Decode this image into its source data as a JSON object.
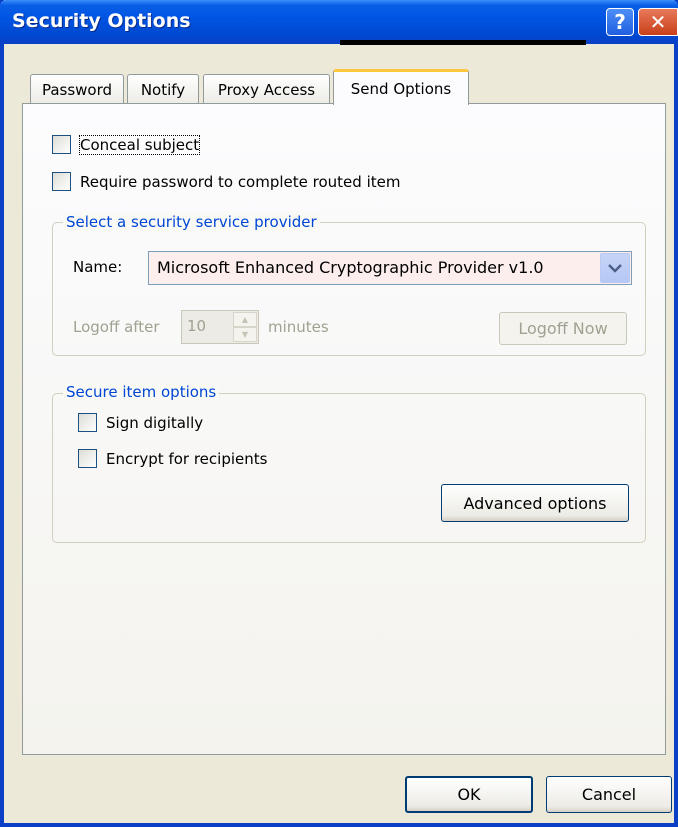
{
  "window": {
    "title": "Security Options"
  },
  "titlebar_buttons": {
    "help": "?",
    "close": "✕"
  },
  "tabs": [
    {
      "label": "Password"
    },
    {
      "label": "Notify"
    },
    {
      "label": "Proxy Access"
    },
    {
      "label": "Send Options",
      "active": true
    }
  ],
  "options": {
    "conceal_subject": {
      "label": "Conceal subject",
      "checked": false
    },
    "require_password": {
      "label": "Require password to complete routed item",
      "checked": false
    }
  },
  "provider_group": {
    "title": "Select a security service provider",
    "name_label": "Name:",
    "name_value": "Microsoft Enhanced Cryptographic Provider v1.0",
    "logoff_label": "Logoff after",
    "logoff_value": "10",
    "minutes_label": "minutes",
    "logoff_now_label": "Logoff Now"
  },
  "secure_group": {
    "title": "Secure item options",
    "sign_digitally": {
      "label": "Sign digitally",
      "checked": false
    },
    "encrypt": {
      "label": "Encrypt for recipients",
      "checked": false
    },
    "advanced_label": "Advanced options"
  },
  "footer": {
    "ok_label": "OK",
    "cancel_label": "Cancel"
  }
}
